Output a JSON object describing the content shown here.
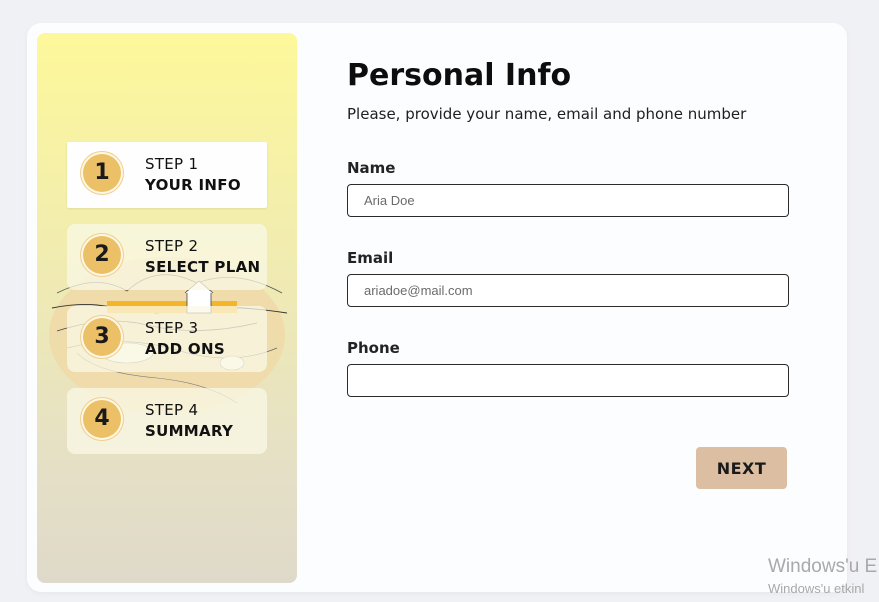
{
  "sidebar": {
    "steps": [
      {
        "number": "1",
        "label": "STEP 1",
        "title": "YOUR INFO",
        "active": true
      },
      {
        "number": "2",
        "label": "STEP 2",
        "title": "SELECT PLAN",
        "active": false
      },
      {
        "number": "3",
        "label": "STEP 3",
        "title": "ADD ONS",
        "active": false
      },
      {
        "number": "4",
        "label": "STEP 4",
        "title": "SUMMARY",
        "active": false
      }
    ]
  },
  "main": {
    "title": "Personal Info",
    "subtitle": "Please, provide your name, email and phone number",
    "fields": {
      "name": {
        "label": "Name",
        "placeholder": "Aria Doe",
        "value": ""
      },
      "email": {
        "label": "Email",
        "placeholder": "ariadoe@mail.com",
        "value": ""
      },
      "phone": {
        "label": "Phone",
        "placeholder": "",
        "value": ""
      }
    },
    "next_label": "NEXT"
  },
  "watermark": {
    "line1": "Windows'u E",
    "line2": "Windows'u etkinl"
  },
  "colors": {
    "step_circle": "#ecc067",
    "next_button": "#dcbfa2",
    "sidebar_top": "#fdf89a",
    "sidebar_bottom": "#dfd9ca"
  }
}
